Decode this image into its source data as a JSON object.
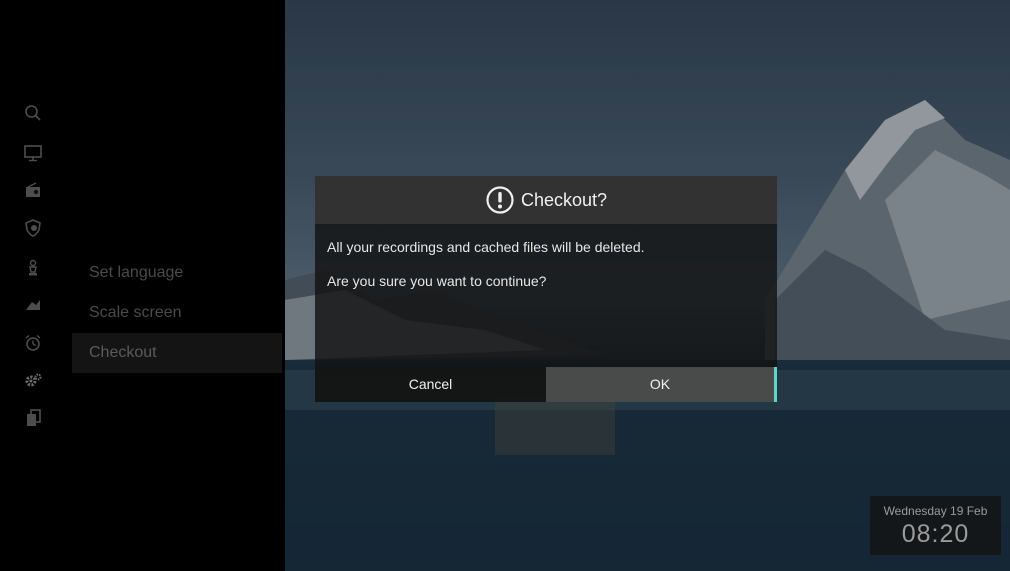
{
  "sidebar": {
    "menu": [
      {
        "label": "Set language"
      },
      {
        "label": "Scale screen"
      },
      {
        "label": "Checkout",
        "active": true
      }
    ],
    "icons": [
      "search-icon",
      "tv-icon",
      "radio-icon",
      "shield-icon",
      "chess-icon",
      "recordings-icon",
      "alarm-icon",
      "settings-icon",
      "apps-icon"
    ]
  },
  "dialog": {
    "title": "Checkout?",
    "lines": [
      "All your recordings and cached files will be deleted.",
      "Are you sure you want to continue?"
    ],
    "cancel_label": "Cancel",
    "ok_label": "OK",
    "accent": "#5fd6c8"
  },
  "clock": {
    "date": "Wednesday 19 Feb",
    "time": "08:20"
  }
}
